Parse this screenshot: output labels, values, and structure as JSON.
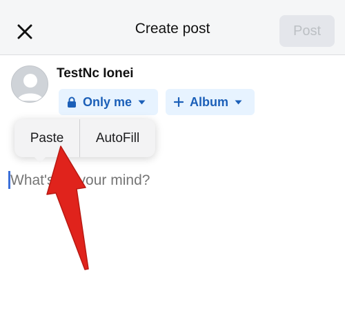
{
  "header": {
    "title": "Create post",
    "post_label": "Post"
  },
  "icons": {
    "close": "close-icon",
    "avatar": "user-avatar-icon",
    "lock": "lock-icon",
    "plus": "plus-icon",
    "caret": "caret-down-icon"
  },
  "user": {
    "name": "TestNc Ionei"
  },
  "privacy": {
    "label": "Only me"
  },
  "album": {
    "label": "Album"
  },
  "popup": {
    "paste_label": "Paste",
    "autofill_label": "AutoFill"
  },
  "composer": {
    "placeholder": "What's on your mind?"
  },
  "colors": {
    "accent": "#1b5fb8",
    "chip_bg": "#e7f3ff",
    "annotation_arrow": "#e0231c"
  }
}
